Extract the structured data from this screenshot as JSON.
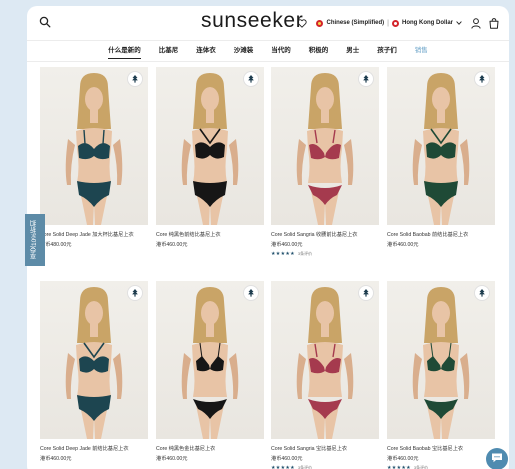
{
  "header": {
    "logo": "sunseeker",
    "language": "Chinese (Simplified)",
    "separator": "|",
    "currency": "Hong Kong Dollar"
  },
  "nav": [
    {
      "label": "什么是新的",
      "active": true
    },
    {
      "label": "比基尼"
    },
    {
      "label": "连体衣"
    },
    {
      "label": "沙滩装"
    },
    {
      "label": "当代的"
    },
    {
      "label": "积极的"
    },
    {
      "label": "男士"
    },
    {
      "label": "孩子们"
    },
    {
      "label": "销售",
      "sale": true
    }
  ],
  "side_tab": {
    "label": "享受10%折扣"
  },
  "products": [
    {
      "title": "Core Solid Deep Jade 加大杯比基尼上衣",
      "price": "港币480.00元",
      "swim": "#1d4550",
      "style": "balconette",
      "rating": false,
      "reviews": ""
    },
    {
      "title": "Core 纯黑色前结比基尼上衣",
      "price": "港币460.00元",
      "swim": "#161616",
      "style": "halter",
      "rating": false,
      "reviews": ""
    },
    {
      "title": "Core Solid Sangria 收腰前比基尼上衣",
      "price": "港币460.00元",
      "swim": "#a53a4e",
      "style": "plunge",
      "rating": true,
      "reviews": "3条评价"
    },
    {
      "title": "Core Solid Baobab 前结比基尼上衣",
      "price": "港币460.00元",
      "swim": "#1f4a36",
      "style": "halter",
      "rating": false,
      "reviews": ""
    },
    {
      "title": "Core Solid Deep Jade 前结比基尼上衣",
      "price": "港币460.00元",
      "swim": "#1d4550",
      "style": "halter",
      "rating": false,
      "reviews": ""
    },
    {
      "title": "Core 纯黑色金比基尼上衣",
      "price": "港币460.00元",
      "swim": "#161616",
      "style": "bralette",
      "rating": false,
      "reviews": ""
    },
    {
      "title": "Core Solid Sangria 宝比基尼上衣",
      "price": "港币460.00元",
      "swim": "#a53a4e",
      "style": "plunge",
      "rating": true,
      "reviews": "3条评价"
    },
    {
      "title": "Core Solid Baobab 宝比基尼上衣",
      "price": "港币460.00元",
      "swim": "#1f4a36",
      "style": "bralette",
      "rating": true,
      "reviews": "3条评价"
    }
  ],
  "rating_stars": "★★★★★",
  "colors": {
    "accent": "#5d8ba7",
    "sale": "#6aa3c8",
    "chat": "#4f8bb0"
  }
}
